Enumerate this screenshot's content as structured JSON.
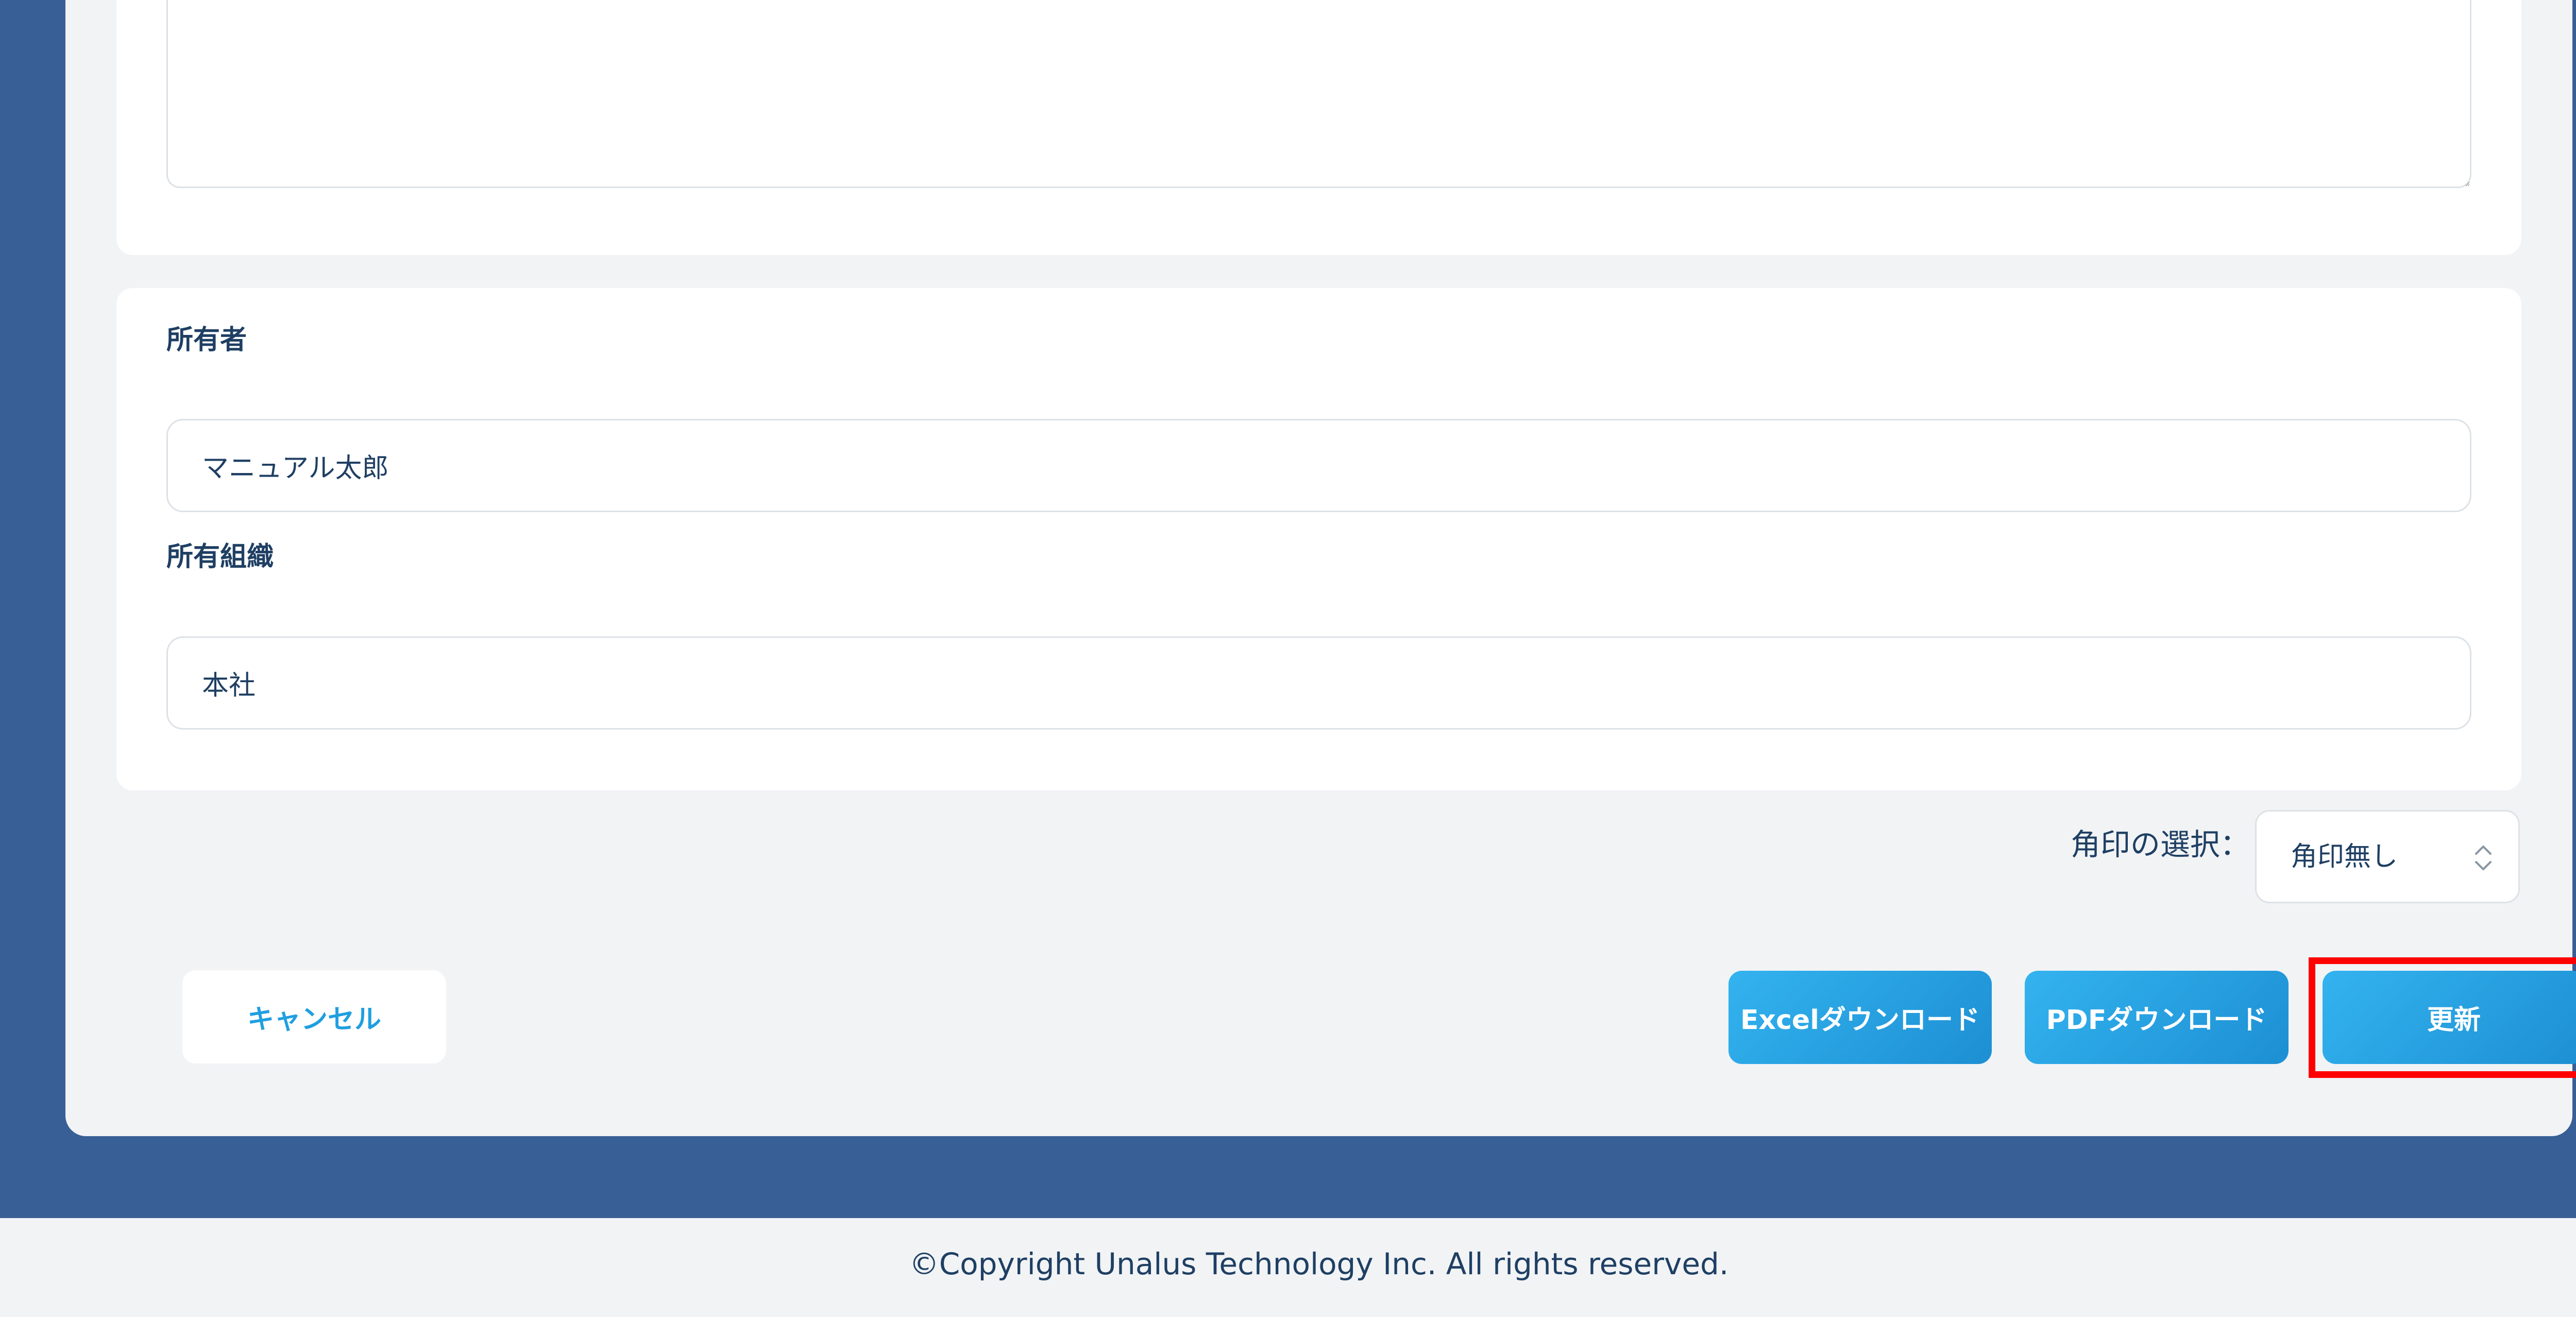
{
  "form": {
    "memo_value": "",
    "owner": {
      "label": "所有者",
      "value": "マニュアル太郎"
    },
    "organization": {
      "label": "所有組織",
      "value": "本社"
    },
    "stamp": {
      "label": "角印の選択：",
      "selected": "角印無し"
    }
  },
  "actions": {
    "cancel_label": "キャンセル",
    "excel_download_label": "Excelダウンロード",
    "pdf_download_label": "PDFダウンロード",
    "update_label": "更新"
  },
  "annotation": {
    "highlight_color": "#ff0000",
    "highlight_target": "update-button"
  },
  "footer": {
    "copyright": "©Copyright Unalus Technology Inc. All rights reserved."
  },
  "colors": {
    "page_background": "#385f96",
    "card_background": "#f1f3f5",
    "primary_button": "#1d8fd3",
    "cancel_text": "#1f9fe0",
    "text": "#1f3f63"
  },
  "icons": {
    "stamp_select": "chevron-up-down-icon"
  }
}
